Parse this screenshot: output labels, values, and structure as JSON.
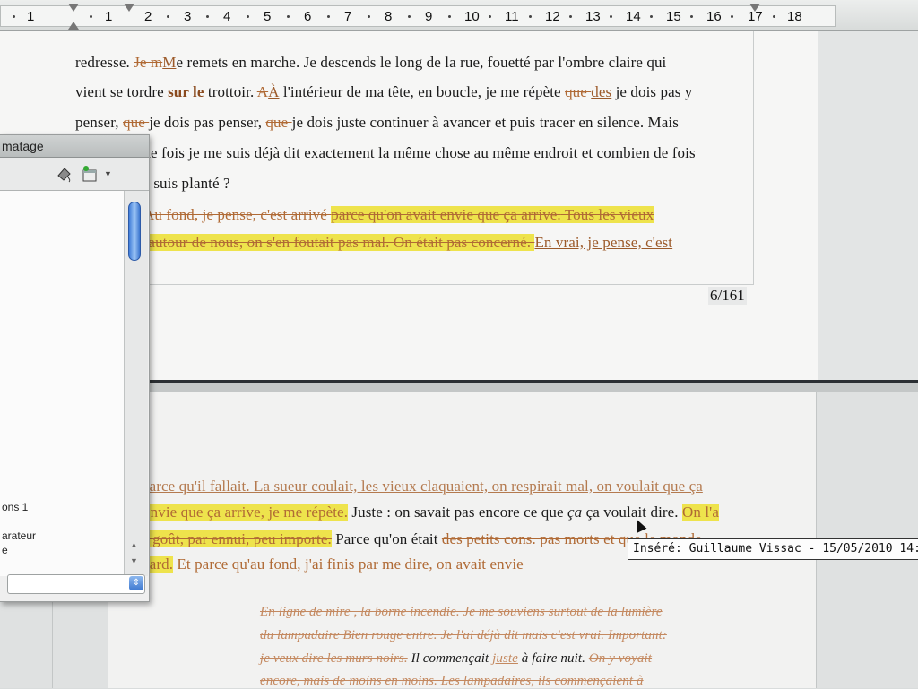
{
  "ruler": {
    "numbers": [
      "1",
      "1",
      "2",
      "3",
      "4",
      "5",
      "6",
      "7",
      "8",
      "9",
      "10",
      "11",
      "12",
      "13",
      "14",
      "15",
      "16",
      "17",
      "18"
    ]
  },
  "top_page": {
    "line1": {
      "a": "redresse. ",
      "del": "Je m",
      "ins": "M",
      "b": "e remets en marche. Je descends le long de la rue, fouetté par l'ombre claire qui"
    },
    "line2": {
      "a": "vient se tordre ",
      "bold": "sur le",
      "b": " trottoir. ",
      "del": "A",
      "ins": "À",
      "c": " l'intérieur de ma tête, en boucle, je me répète ",
      "del2": "que ",
      "ins2": "des",
      "d": " je dois pas y"
    },
    "line3": {
      "a": "penser, ",
      "del": "que ",
      "b": "je dois pas penser, ",
      "del2": "que ",
      "c": "je dois juste continuer à avancer et puis tracer en silence. Mais"
    },
    "line4": "ien de fois je me suis déjà dit exactement la même chose au même endroit et combien de fois",
    "line5": "e me suis planté ?",
    "line6": {
      "del": "Au fond, je pense, c'est arrivé ",
      "hl": "parce qu'on avait envie que ça arrive.",
      "hl2": " Tous les vieux"
    },
    "line7": {
      "hl": "ent autour de nous, on s'en foutait pas mal. On était pas concerné. ",
      "ins": "En vrai, je pense, c'est"
    },
    "page_counter": "6/161"
  },
  "bottom_page": {
    "line1": "parce qu'il fallait. La sueur coulait, les vieux claquaient, on respirait mal, on voulait que ça",
    "line2": {
      "hl": "envie que ça arrive, je me répète.",
      "a": " Juste : on savait pas encore ce que ",
      "ital": "ça",
      "b": " ça voulait dire. ",
      "hl2": "On l'a"
    },
    "line3": {
      "hl": "r goût, par ennui,  peu importe.",
      "a": " Parce qu'on était ",
      "del": "des petits cons.  pas morts et que le monde"
    },
    "line4": {
      "hl": "sard.",
      "del": " Et parce qu'au fond, j'ai finis par me dire, on avait envie"
    },
    "line5": "En ligne de mire , la borne incendie. Je me souviens surtout de la lumière",
    "line6": "du lampadaire Bien rouge entre. Je l'ai déjà dit mais c'est vrai. Important:",
    "line7": {
      "del": "je veux dire les murs noirs.",
      "a": " Il commençait ",
      "ins": "juste",
      "b": " à faire nuit. ",
      "del2": "On y voyait"
    },
    "line8": "encore, mais de moins en moins. Les lampadaires, ils commençaient à"
  },
  "panel": {
    "title": "matage",
    "items": [
      "ons 1",
      "arateur",
      "e"
    ]
  },
  "tooltip": {
    "text": "Inséré: Guillaume Vissac - 15/05/2010 14:25"
  },
  "colors": {
    "highlight": "#eee34c",
    "tracked_change": "#b06a35"
  }
}
